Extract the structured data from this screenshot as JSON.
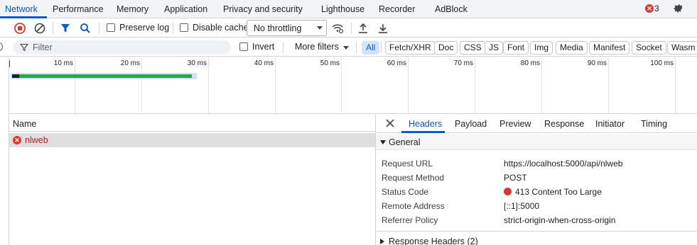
{
  "top_tabs": [
    {
      "label": "Network",
      "active": true
    },
    {
      "label": "Performance"
    },
    {
      "label": "Memory"
    },
    {
      "label": "Application"
    },
    {
      "label": "Privacy and security"
    },
    {
      "label": "Lighthouse"
    },
    {
      "label": "Recorder"
    },
    {
      "label": "AdBlock"
    }
  ],
  "error_badge": {
    "count": "3",
    "icon": "error-x-icon",
    "color": "#dc362e"
  },
  "toolbar": {
    "preserve_log_label": "Preserve log",
    "disable_cache_label": "Disable cache",
    "throttling_value": "No throttling"
  },
  "filter": {
    "placeholder": "Filter",
    "invert_label": "Invert",
    "more_filters_label": "More filters",
    "types": [
      "All",
      "Fetch/XHR",
      "Doc",
      "CSS",
      "JS",
      "Font",
      "Img",
      "Media",
      "Manifest",
      "Socket",
      "Wasm"
    ],
    "selected_type": "All"
  },
  "timeline": {
    "ticks": [
      "10 ms",
      "20 ms",
      "30 ms",
      "40 ms",
      "50 ms",
      "60 ms",
      "70 ms",
      "80 ms",
      "90 ms",
      "100 ms"
    ]
  },
  "requests": {
    "column_name": "Name",
    "rows": [
      {
        "name": "nlweb",
        "status": "error"
      }
    ]
  },
  "details": {
    "tabs": [
      "Headers",
      "Payload",
      "Preview",
      "Response",
      "Initiator",
      "Timing"
    ],
    "active_tab": "Headers",
    "general_title": "General",
    "general": [
      {
        "key": "Request URL",
        "value": "https://localhost:5000/api/nlweb"
      },
      {
        "key": "Request Method",
        "value": "POST"
      },
      {
        "key": "Status Code",
        "value": "413 Content Too Large"
      },
      {
        "key": "Remote Address",
        "value": "[::1]:5000"
      },
      {
        "key": "Referrer Policy",
        "value": "strict-origin-when-cross-origin"
      }
    ],
    "response_headers_title": "Response Headers (2)"
  },
  "colors": {
    "accent": "#0b57d0",
    "error": "#dc362e",
    "waterfall": "#28a745"
  }
}
